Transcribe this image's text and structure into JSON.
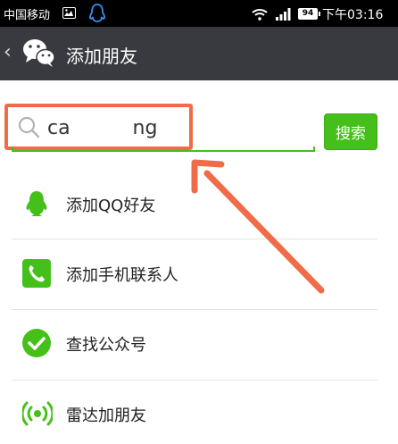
{
  "status_bar": {
    "carrier": "中国移动",
    "battery": "94",
    "time": "下午03:16"
  },
  "title_bar": {
    "title": "添加朋友"
  },
  "search": {
    "value": "ca          ng",
    "button_label": "搜索"
  },
  "menu": [
    {
      "label": "添加QQ好友",
      "icon": "qq-icon"
    },
    {
      "label": "添加手机联系人",
      "icon": "phone-icon"
    },
    {
      "label": "查找公众号",
      "icon": "check-icon"
    },
    {
      "label": "雷达加朋友",
      "icon": "radar-icon"
    }
  ],
  "colors": {
    "accent": "#45c01a",
    "title_bar": "#393a3f",
    "annotation": "#f06b47"
  }
}
